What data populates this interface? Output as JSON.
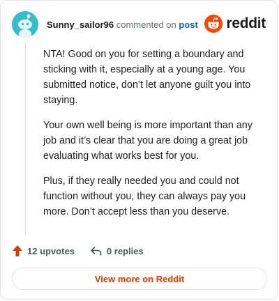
{
  "comment": {
    "username": "Sunny_sailor96",
    "action_text": "commented on",
    "post_link": "post",
    "paragraphs": [
      "NTA! Good on you for setting a boundary and sticking with it, especially at a young age. You submitted notice, don’t let anyone guilt you into staying.",
      "Your own well being is more important than any job and it’s clear that you are doing a great job evaluating what works best for you.",
      "Plus, if they really needed you and could not function without you, they can always pay you more. Don’t accept less than you deserve."
    ]
  },
  "brand": {
    "name": "reddit",
    "icon": "reddit-logo-icon",
    "color": "#ff4500"
  },
  "footer": {
    "upvotes": "12 upvotes",
    "replies": "0 replies",
    "upvote_icon": "upvote-arrow-icon",
    "reply_icon": "reply-arrow-icon"
  },
  "view_button": "View more on Reddit",
  "colors": {
    "accent": "#d93a00",
    "link": "#0a66c2",
    "avatar_bg": "#33bdcf"
  }
}
